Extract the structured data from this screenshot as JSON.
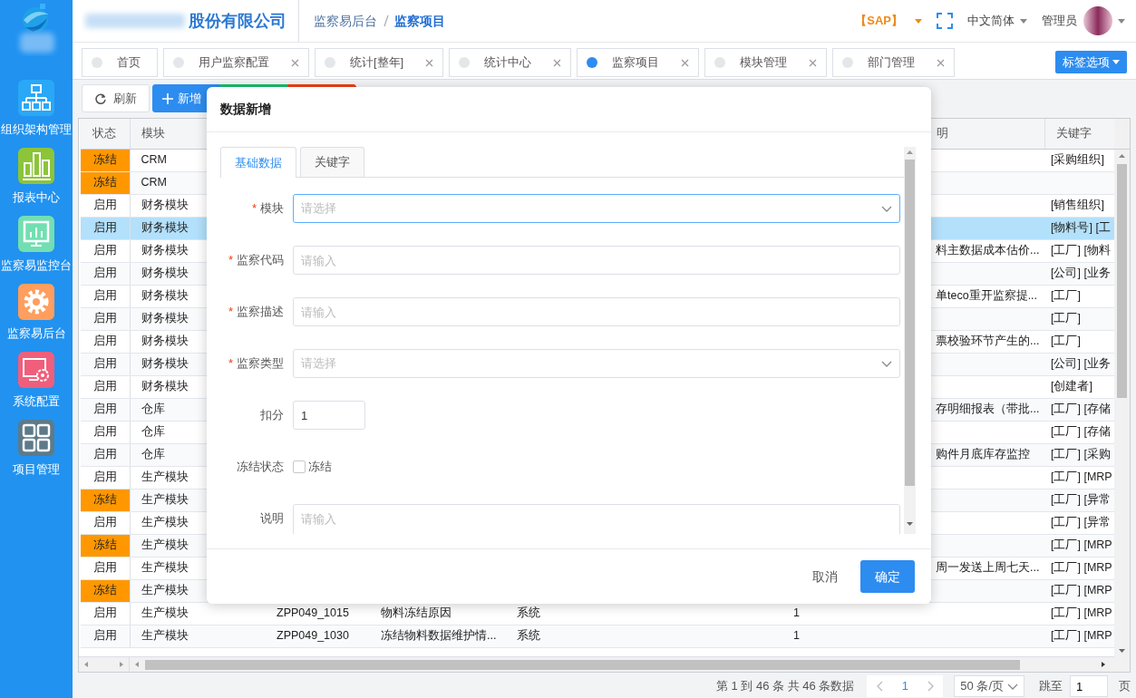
{
  "header": {
    "company_name": "股份有限公司",
    "breadcrumb": [
      "监察易后台",
      "监察项目"
    ],
    "system": "【SAP】",
    "language": "中文简体",
    "user": "管理员"
  },
  "sidebar": {
    "items": [
      {
        "label": "组织架构管理",
        "color": "#29a8f7"
      },
      {
        "label": "报表中心",
        "color": "#8cc43a"
      },
      {
        "label": "监察易监控台",
        "color": "#72dfb2"
      },
      {
        "label": "监察易后台",
        "color": "#ff9e5e"
      },
      {
        "label": "系统配置",
        "color": "#ef5f7c"
      },
      {
        "label": "项目管理",
        "color": "#5d7a8a"
      }
    ]
  },
  "tabs": [
    {
      "label": "首页",
      "closable": false,
      "selected": false
    },
    {
      "label": "用户监察配置",
      "closable": true,
      "selected": false
    },
    {
      "label": "统计[整年]",
      "closable": true,
      "selected": false
    },
    {
      "label": "统计中心",
      "closable": true,
      "selected": false
    },
    {
      "label": "监察项目",
      "closable": true,
      "selected": true
    },
    {
      "label": "模块管理",
      "closable": true,
      "selected": false
    },
    {
      "label": "部门管理",
      "closable": true,
      "selected": false
    }
  ],
  "tab_options_button": "标签选项",
  "toolbar": [
    {
      "label": "刷新",
      "kind": "refresh"
    },
    {
      "label": "新增",
      "kind": "add"
    },
    {
      "kind": "success"
    },
    {
      "kind": "danger"
    }
  ],
  "table": {
    "headers": {
      "status": "状态",
      "module": "模块",
      "column_7": "明",
      "keywords": "关键字"
    },
    "rows": [
      {
        "status": "冻结",
        "frozen": true,
        "selected": false,
        "module": "CRM",
        "keywords": "[采购组织]"
      },
      {
        "status": "冻结",
        "frozen": true,
        "selected": false,
        "module": "CRM"
      },
      {
        "status": "启用",
        "frozen": false,
        "selected": false,
        "module": "财务模块",
        "keywords": "[销售组织]"
      },
      {
        "status": "启用",
        "frozen": false,
        "selected": true,
        "module": "财务模块",
        "keywords": "[物料号] [工"
      },
      {
        "status": "启用",
        "frozen": false,
        "selected": false,
        "module": "财务模块",
        "column_7": "料主数据成本估价...",
        "keywords": "[工厂] [物料"
      },
      {
        "status": "启用",
        "frozen": false,
        "selected": false,
        "module": "财务模块",
        "keywords": "[公司] [业务"
      },
      {
        "status": "启用",
        "frozen": false,
        "selected": false,
        "module": "财务模块",
        "column_7": "单teco重开监察提...",
        "keywords": "[工厂]"
      },
      {
        "status": "启用",
        "frozen": false,
        "selected": false,
        "module": "财务模块",
        "keywords": "[工厂]"
      },
      {
        "status": "启用",
        "frozen": false,
        "selected": false,
        "module": "财务模块",
        "column_7": "票校验环节产生的...",
        "keywords": "[工厂]"
      },
      {
        "status": "启用",
        "frozen": false,
        "selected": false,
        "module": "财务模块",
        "keywords": "[公司] [业务"
      },
      {
        "status": "启用",
        "frozen": false,
        "selected": false,
        "module": "财务模块",
        "keywords": "[创建者]"
      },
      {
        "status": "启用",
        "frozen": false,
        "selected": false,
        "module": "仓库",
        "column_7": "存明细报表（带批...",
        "keywords": "[工厂] [存储"
      },
      {
        "status": "启用",
        "frozen": false,
        "selected": false,
        "module": "仓库",
        "keywords": "[工厂] [存储"
      },
      {
        "status": "启用",
        "frozen": false,
        "selected": false,
        "module": "仓库",
        "column_7": "购件月底库存监控",
        "keywords": "[工厂] [采购"
      },
      {
        "status": "启用",
        "frozen": false,
        "selected": false,
        "module": "生产模块",
        "keywords": "[工厂] [MRP"
      },
      {
        "status": "冻结",
        "frozen": true,
        "selected": false,
        "module": "生产模块",
        "keywords": "[工厂] [异常"
      },
      {
        "status": "启用",
        "frozen": false,
        "selected": false,
        "module": "生产模块",
        "keywords": "[工厂] [异常"
      },
      {
        "status": "冻结",
        "frozen": true,
        "selected": false,
        "module": "生产模块",
        "keywords": "[工厂] [MRP"
      },
      {
        "status": "启用",
        "frozen": false,
        "selected": false,
        "module": "生产模块",
        "column_7": "周一发送上周七天...",
        "keywords": "[工厂] [MRP"
      },
      {
        "status": "冻结",
        "frozen": true,
        "selected": false,
        "module": "生产模块",
        "keywords": "[工厂] [MRP"
      },
      {
        "status": "启用",
        "frozen": false,
        "selected": false,
        "module": "生产模块",
        "column_3": "ZPP049_1015",
        "column_4": "物料冻结原因",
        "column_5": "系统",
        "column_6": "1",
        "keywords": "[工厂] [MRP"
      },
      {
        "status": "启用",
        "frozen": false,
        "selected": false,
        "module": "生产模块",
        "column_3": "ZPP049_1030",
        "column_4": "冻结物料数据维护情...",
        "column_5": "系统",
        "column_6": "1",
        "keywords": "[工厂] [MRP"
      }
    ]
  },
  "pagination": {
    "summary": "第 1 到 46 条 共 46 条数据",
    "pages": [
      {
        "label": "1",
        "selected": true
      }
    ],
    "page_size": "50 条/页",
    "jump_label": "跳至",
    "jump_value": "1",
    "page_unit": "页"
  },
  "dialog": {
    "title": "数据新增",
    "tabs": [
      {
        "label": "基础数据",
        "selected": true
      },
      {
        "label": "关键字",
        "selected": false
      }
    ],
    "fields": [
      {
        "label": "模块",
        "required_mark": "*",
        "kind": "select",
        "placeholder": "请选择",
        "focused": true
      },
      {
        "label": "监察代码",
        "required_mark": "*",
        "kind": "input",
        "placeholder": "请输入",
        "focused": false
      },
      {
        "label": "监察描述",
        "required_mark": "*",
        "kind": "input",
        "placeholder": "请输入",
        "focused": false
      },
      {
        "label": "监察类型",
        "required_mark": "*",
        "kind": "select",
        "placeholder": "请选择",
        "focused": false
      },
      {
        "label": "扣分",
        "kind": "number",
        "value": "1",
        "focused": false
      },
      {
        "label": "冻结状态",
        "kind": "checkbox",
        "option_label": "冻结",
        "checked": false
      },
      {
        "label": "说明",
        "kind": "textarea",
        "placeholder": "请输入",
        "focused": false
      }
    ],
    "buttons": [
      {
        "label": "取消",
        "kind": "text"
      },
      {
        "label": "确定",
        "kind": "primary"
      }
    ]
  }
}
